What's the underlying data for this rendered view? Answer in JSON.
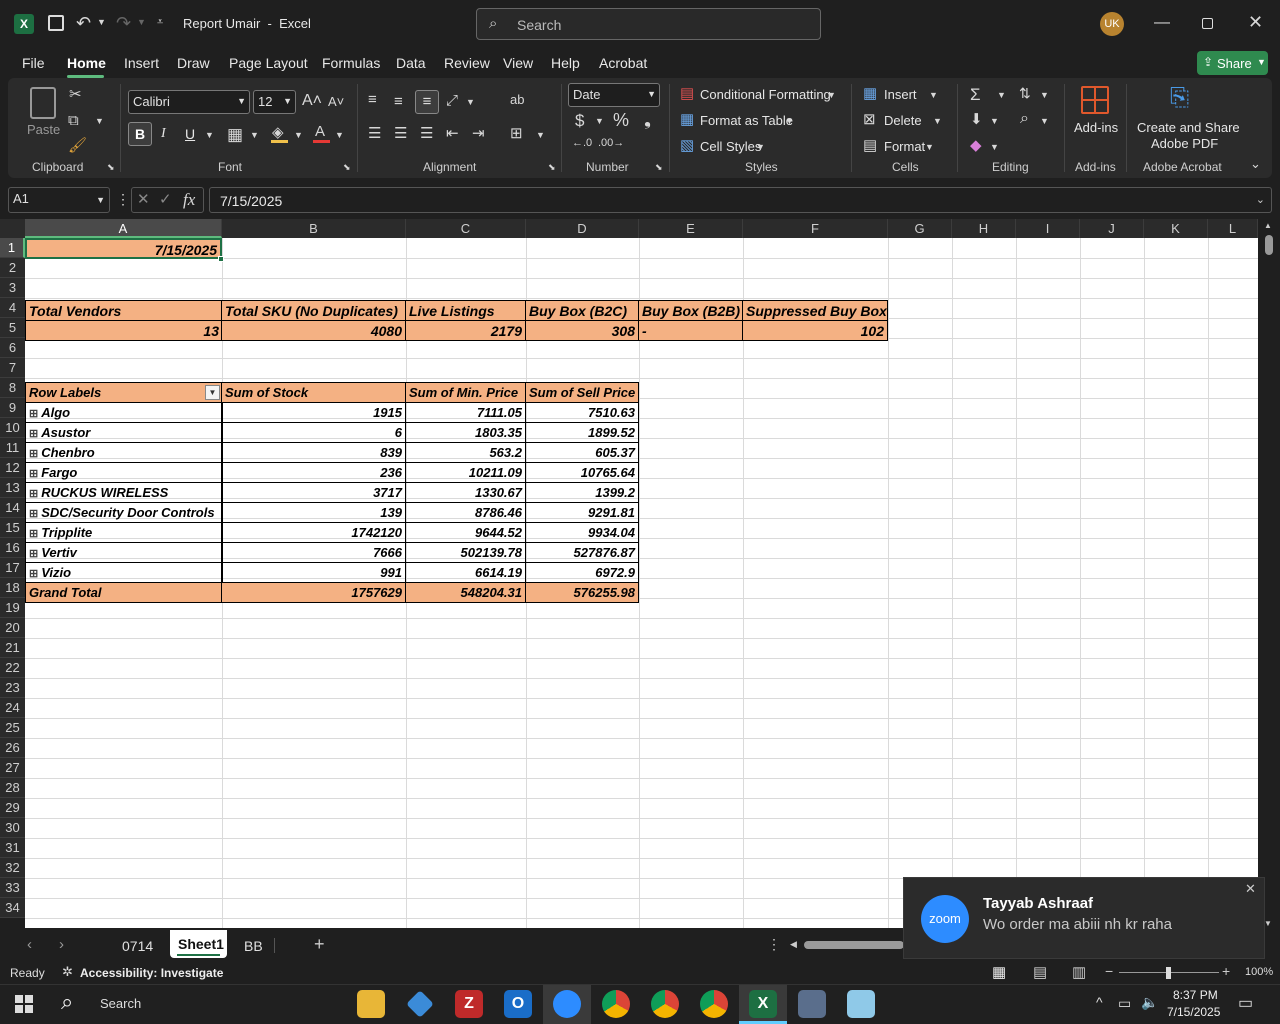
{
  "window": {
    "title": "Report Umair  -  Excel",
    "search_placeholder": "Search",
    "user_initials": "UK"
  },
  "menu": {
    "file": "File",
    "home": "Home",
    "insert": "Insert",
    "draw": "Draw",
    "page_layout": "Page Layout",
    "formulas": "Formulas",
    "data": "Data",
    "review": "Review",
    "view": "View",
    "help": "Help",
    "acrobat": "Acrobat",
    "share": "Share"
  },
  "ribbon": {
    "clipboard": {
      "label": "Clipboard",
      "paste": "Paste"
    },
    "font": {
      "label": "Font",
      "name": "Calibri",
      "size": "12",
      "bold": "B",
      "italic": "I",
      "underline": "U"
    },
    "alignment": {
      "label": "Alignment"
    },
    "number": {
      "label": "Number",
      "format": "Date"
    },
    "styles": {
      "label": "Styles",
      "conditional": "Conditional Formatting",
      "format_table": "Format as Table",
      "cell_styles": "Cell Styles"
    },
    "cells": {
      "label": "Cells",
      "insert": "Insert",
      "delete": "Delete",
      "format": "Format"
    },
    "editing": {
      "label": "Editing"
    },
    "addins": {
      "label": "Add-ins",
      "button": "Add-ins"
    },
    "acrobat": {
      "label": "Adobe Acrobat",
      "line1": "Create and Share",
      "line2": "Adobe PDF"
    }
  },
  "formula_bar": {
    "name_box": "A1",
    "value": "7/15/2025"
  },
  "columns": [
    "A",
    "B",
    "C",
    "D",
    "E",
    "F",
    "G",
    "H",
    "I",
    "J",
    "K",
    "L"
  ],
  "rows": [
    "1",
    "2",
    "3",
    "4",
    "5",
    "6",
    "7",
    "8",
    "9",
    "10",
    "11",
    "12",
    "13",
    "14",
    "15",
    "16",
    "17",
    "18",
    "19",
    "20",
    "21",
    "22",
    "23",
    "24",
    "25",
    "26",
    "27",
    "28",
    "29",
    "30",
    "31",
    "32",
    "33",
    "34"
  ],
  "sheet": {
    "a1": "7/15/2025",
    "summary_headers": [
      "Total Vendors",
      "Total SKU (No Duplicates)",
      "Live Listings",
      "Buy Box (B2C)",
      "Buy Box (B2B)",
      "Suppressed Buy Box"
    ],
    "summary_values": [
      "13",
      "4080",
      "2179",
      "308",
      "-",
      "102"
    ],
    "pivot_headers": [
      "Row Labels",
      "Sum of Stock",
      "Sum of Min. Price",
      "Sum of Sell Price"
    ],
    "pivot_rows": [
      [
        "Algo",
        "1915",
        "7111.05",
        "7510.63"
      ],
      [
        "Asustor",
        "6",
        "1803.35",
        "1899.52"
      ],
      [
        "Chenbro",
        "839",
        "563.2",
        "605.37"
      ],
      [
        "Fargo",
        "236",
        "10211.09",
        "10765.64"
      ],
      [
        "RUCKUS WIRELESS",
        "3717",
        "1330.67",
        "1399.2"
      ],
      [
        "SDC/Security Door Controls",
        "139",
        "8786.46",
        "9291.81"
      ],
      [
        "Tripplite",
        "1742120",
        "9644.52",
        "9934.04"
      ],
      [
        "Vertiv",
        "7666",
        "502139.78",
        "527876.87"
      ],
      [
        "Vizio",
        "991",
        "6614.19",
        "6972.9"
      ]
    ],
    "grand_total": [
      "Grand Total",
      "1757629",
      "548204.31",
      "576255.98"
    ]
  },
  "tabs": [
    "0714",
    "Sheet1",
    "BB"
  ],
  "status": {
    "ready": "Ready",
    "accessibility": "Accessibility: Investigate",
    "zoom": "100%"
  },
  "toast": {
    "app": "zoom",
    "name": "Tayyab Ashraaf",
    "message": "Wo order ma abiii nh kr raha"
  },
  "taskbar": {
    "search": "Search",
    "time": "8:37 PM",
    "date": "7/15/2025"
  }
}
